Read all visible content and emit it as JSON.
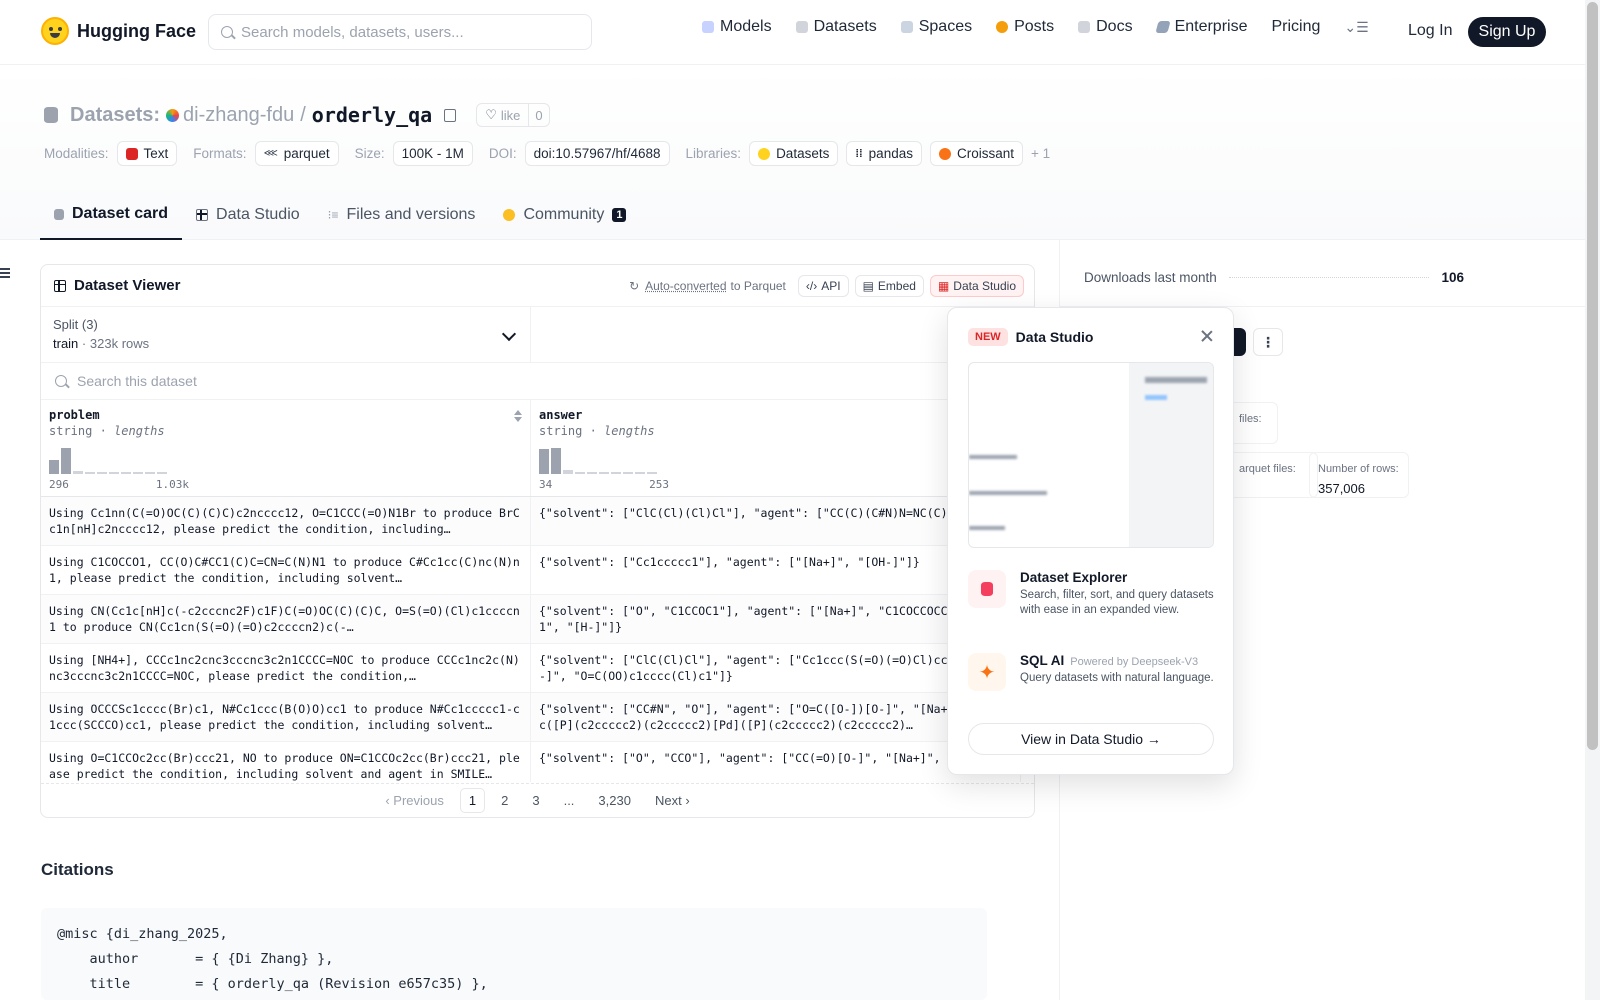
{
  "nav": {
    "brand": "Hugging Face",
    "search_placeholder": "Search models, datasets, users...",
    "links": [
      "Models",
      "Datasets",
      "Spaces",
      "Posts",
      "Docs",
      "Enterprise",
      "Pricing"
    ],
    "login": "Log In",
    "signup": "Sign Up"
  },
  "header": {
    "crumb_label": "Datasets:",
    "owner": "di-zhang-fdu",
    "slash": "/",
    "repo": "orderly_qa",
    "like_label": "like",
    "like_count": "0",
    "modalities_label": "Modalities:",
    "modality": "Text",
    "formats_label": "Formats:",
    "format": "parquet",
    "size_label": "Size:",
    "size": "100K - 1M",
    "doi_label": "DOI:",
    "doi": "doi:10.57967/hf/4688",
    "libraries_label": "Libraries:",
    "libraries": [
      "Datasets",
      "pandas",
      "Croissant"
    ],
    "libraries_more": "+ 1"
  },
  "tabs": [
    "Dataset card",
    "Data Studio",
    "Files and versions",
    "Community"
  ],
  "community_badge": "1",
  "viewer": {
    "title": "Dataset Viewer",
    "auto_converted": "Auto-converted",
    "to_parquet": "to Parquet",
    "api": "API",
    "embed": "Embed",
    "data_studio": "Data Studio",
    "split_label": "Split (3)",
    "split_value": "train",
    "split_rows": "323k rows",
    "search_placeholder": "Search this dataset",
    "columns": [
      {
        "name": "problem",
        "type": "string",
        "stat": "lengths",
        "min": "296",
        "max": "1.03k",
        "hist": [
          0.55,
          1.0,
          0.1,
          0.05,
          0.05,
          0.05,
          0.05,
          0.05,
          0.05,
          0.05
        ]
      },
      {
        "name": "answer",
        "type": "string",
        "stat": "lengths",
        "min": "34",
        "max": "253",
        "hist": [
          0.95,
          1.0,
          0.15,
          0.05,
          0.05,
          0.05,
          0.05,
          0.05,
          0.05,
          0.05
        ]
      }
    ],
    "rows": [
      [
        "Using Cc1nn(C(=O)OC(C)(C)C)c2ncccc12, O=C1CCC(=O)N1Br to produce BrCc1n[nH]c2ncccc12, please predict the condition, including…",
        "{\"solvent\": [\"ClC(Cl)(Cl)Cl\"], \"agent\": [\"CC(C)(C#N)N=NC(C)(C)C#N\"]}"
      ],
      [
        "Using C1COCCO1, CC(O)C#CC1(C)C=CN=C(N)N1 to produce C#Cc1cc(C)nc(N)n1, please predict the condition, including solvent…",
        "{\"solvent\": [\"Cc1ccccc1\"], \"agent\": [\"[Na+]\", \"[OH-]\"]}"
      ],
      [
        "Using CN(Cc1c[nH]c(-c2cccnc2F)c1F)C(=O)OC(C)(C)C, O=S(=O)(Cl)c1ccccn1 to produce CN(Cc1cn(S(=O)(=O)c2ccccn2)c(-…",
        "{\"solvent\": [\"O\", \"C1CCOC1\"], \"agent\": [\"[Na+]\", \"C1COCCOCCOCCOCCO1\", \"[H-]\"]}"
      ],
      [
        "Using [NH4+], CCCc1nc2cnc3cccnc3c2n1CCCC=NOC to produce CCCc1nc2c(N)nc3cccnc3c2n1CCCC=NOC, please predict the condition,…",
        "{\"solvent\": [\"ClC(Cl)Cl\"], \"agent\": [\"Cc1ccc(S(=O)(=O)Cl)cc1\", \"[OH-]\", \"O=C(OO)c1cccc(Cl)c1\"]}"
      ],
      [
        "Using OCCCSc1cccc(Br)c1, N#Cc1ccc(B(O)O)cc1 to produce N#Cc1ccccc1-c1ccc(SCCCO)cc1, please predict the condition, including solvent…",
        "{\"solvent\": [\"CC#N\", \"O\"], \"agent\": [\"O=C([O-])[O-]\", \"[Na+]\", \"c1ccc([P](c2ccccc2)(c2ccccc2)[Pd]([P](c2ccccc2)(c2ccccc2)…"
      ],
      [
        "Using O=C1CCOc2cc(Br)ccc21, NO to produce ON=C1CCOc2cc(Br)ccc21, please predict the condition, including solvent and agent in SMILE…",
        "{\"solvent\": [\"O\", \"CCO\"], \"agent\": [\"CC(=O)[O-]\", \"[Na+]\", …"
      ]
    ],
    "pager": {
      "prev": "Previous",
      "pages": [
        "1",
        "2",
        "3",
        "...",
        "3,230"
      ],
      "next": "Next"
    }
  },
  "right": {
    "downloads_label": "Downloads last month",
    "downloads_value": "106",
    "stat1_label": "files:",
    "stat2_label": "arquet files:",
    "stat3_label": "Number of rows:",
    "stat3_value": "357,006"
  },
  "popover": {
    "badge": "NEW",
    "title": "Data Studio",
    "feature1_title": "Dataset Explorer",
    "feature1_desc": "Search, filter, sort, and query datasets with ease in an expanded view.",
    "feature2_title": "SQL AI",
    "feature2_sub": "Powered by Deepseek-V3",
    "feature2_desc": "Query datasets with natural language.",
    "cta": "View in Data Studio →"
  },
  "citations": {
    "title": "Citations",
    "code": "@misc {di_zhang_2025,\n    author       = { {Di Zhang} },\n    title        = { orderly_qa (Revision e657c35) },"
  }
}
